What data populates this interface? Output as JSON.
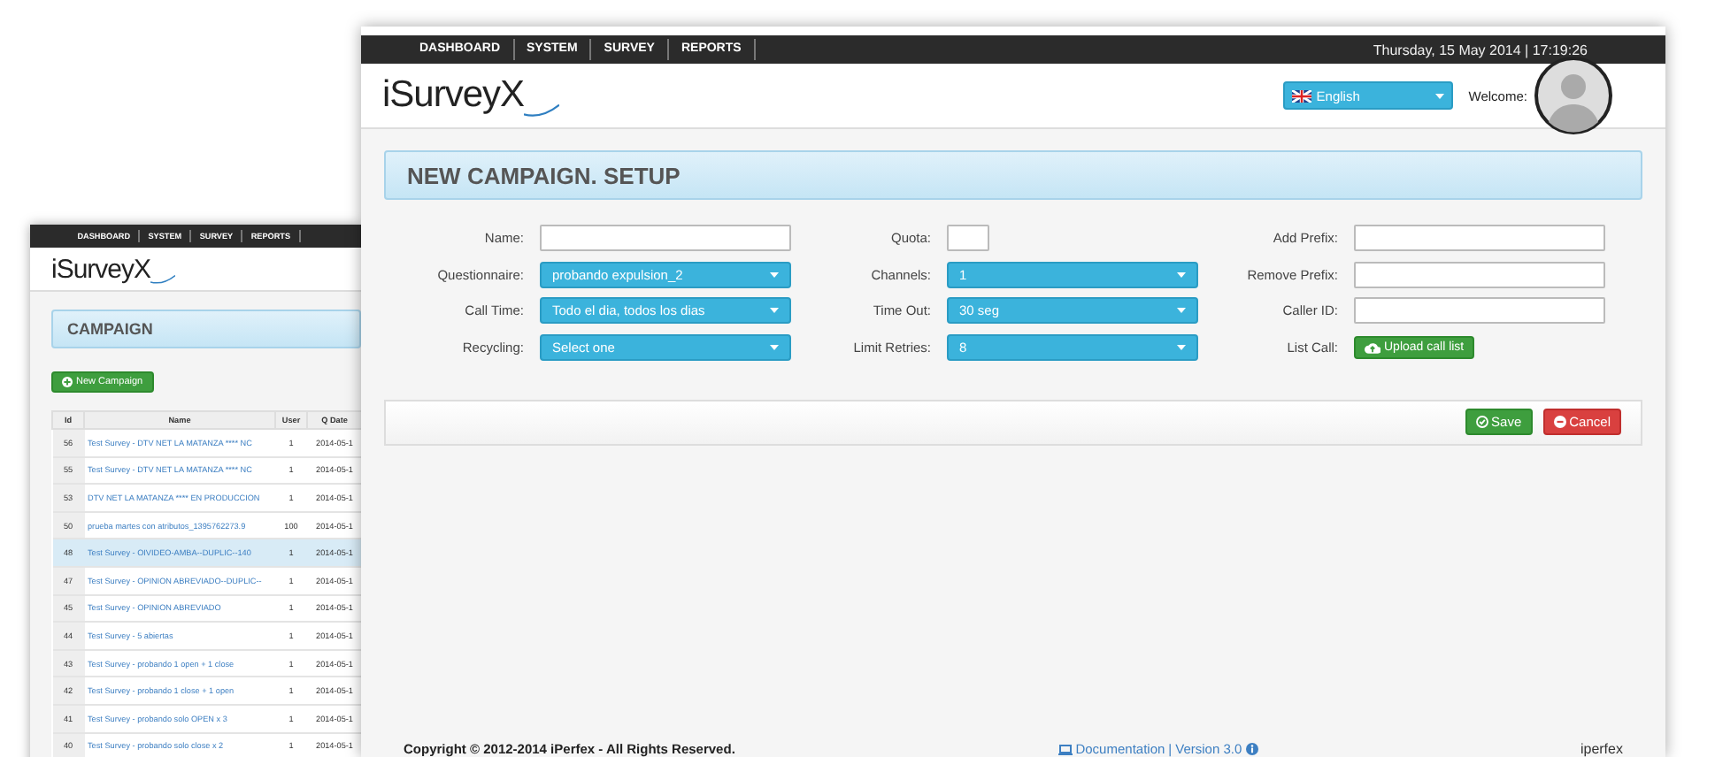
{
  "back_window": {
    "nav": [
      "DASHBOARD",
      "SYSTEM",
      "SURVEY",
      "REPORTS"
    ],
    "logo": "iSurveyX",
    "title": "CAMPAIGN",
    "new_button": "New Campaign",
    "table": {
      "columns": [
        "Id",
        "Name",
        "User",
        "Q Date"
      ],
      "rows": [
        {
          "id": "56",
          "name": "Test Survey - DTV NET LA MATANZA **** NC",
          "user": "1",
          "date": "2014-05-1",
          "selected": false
        },
        {
          "id": "55",
          "name": "Test Survey - DTV NET LA MATANZA **** NC",
          "user": "1",
          "date": "2014-05-1",
          "selected": false
        },
        {
          "id": "53",
          "name": "DTV NET LA MATANZA **** EN PRODUCCION",
          "user": "1",
          "date": "2014-05-1",
          "selected": false
        },
        {
          "id": "50",
          "name": "prueba martes con atributos_1395762273.9",
          "user": "100",
          "date": "2014-05-1",
          "selected": false
        },
        {
          "id": "48",
          "name": "Test Survey - OIVIDEO-AMBA--DUPLIC--140",
          "user": "1",
          "date": "2014-05-1",
          "selected": true
        },
        {
          "id": "47",
          "name": "Test Survey - OPINION ABREVIADO--DUPLIC--",
          "user": "1",
          "date": "2014-05-1",
          "selected": false
        },
        {
          "id": "45",
          "name": "Test Survey - OPINION ABREVIADO",
          "user": "1",
          "date": "2014-05-1",
          "selected": false
        },
        {
          "id": "44",
          "name": "Test Survey - 5 abiertas",
          "user": "1",
          "date": "2014-05-1",
          "selected": false
        },
        {
          "id": "43",
          "name": "Test Survey - probando 1 open + 1 close",
          "user": "1",
          "date": "2014-05-1",
          "selected": false
        },
        {
          "id": "42",
          "name": "Test Survey - probando 1 close + 1 open",
          "user": "1",
          "date": "2014-05-1",
          "selected": false
        },
        {
          "id": "41",
          "name": "Test Survey - probando solo OPEN x 3",
          "user": "1",
          "date": "2014-05-1",
          "selected": false
        },
        {
          "id": "40",
          "name": "Test Survey - probando solo close x 2",
          "user": "1",
          "date": "2014-05-1",
          "selected": false
        }
      ]
    }
  },
  "front_window": {
    "nav": [
      "DASHBOARD",
      "SYSTEM",
      "SURVEY",
      "REPORTS"
    ],
    "datetime": "Thursday, 15 May 2014 | 17:19:26",
    "logo": "iSurveyX",
    "language": "English",
    "welcome": "Welcome:",
    "title": "NEW CAMPAIGN. SETUP",
    "form": [
      {
        "label": "Name:",
        "kind": "text"
      },
      {
        "label": "Quota:",
        "kind": "number"
      },
      {
        "label": "Add Prefix:",
        "kind": "text"
      },
      {
        "label": "Questionnaire:",
        "kind": "select",
        "value": "probando expulsion_2"
      },
      {
        "label": "Channels:",
        "kind": "select",
        "value": "1"
      },
      {
        "label": "Remove Prefix:",
        "kind": "text"
      },
      {
        "label": "Call Time:",
        "kind": "select",
        "value": "Todo el dia, todos los dias"
      },
      {
        "label": "Time Out:",
        "kind": "select",
        "value": "30 seg"
      },
      {
        "label": "Caller ID:",
        "kind": "text"
      },
      {
        "label": "Recycling:",
        "kind": "select",
        "value": "Select one"
      },
      {
        "label": "Limit Retries:",
        "kind": "select",
        "value": "8"
      },
      {
        "label": "List Call:",
        "kind": "upload",
        "value": "Upload call list"
      }
    ],
    "save": "Save",
    "cancel": "Cancel",
    "footer": {
      "copyright": "Copyright © 2012-2014 iPerfex - All Rights Reserved.",
      "documentation": "Documentation",
      "separator": "|",
      "version": "Version 3.0",
      "brand": "iperfex"
    }
  }
}
